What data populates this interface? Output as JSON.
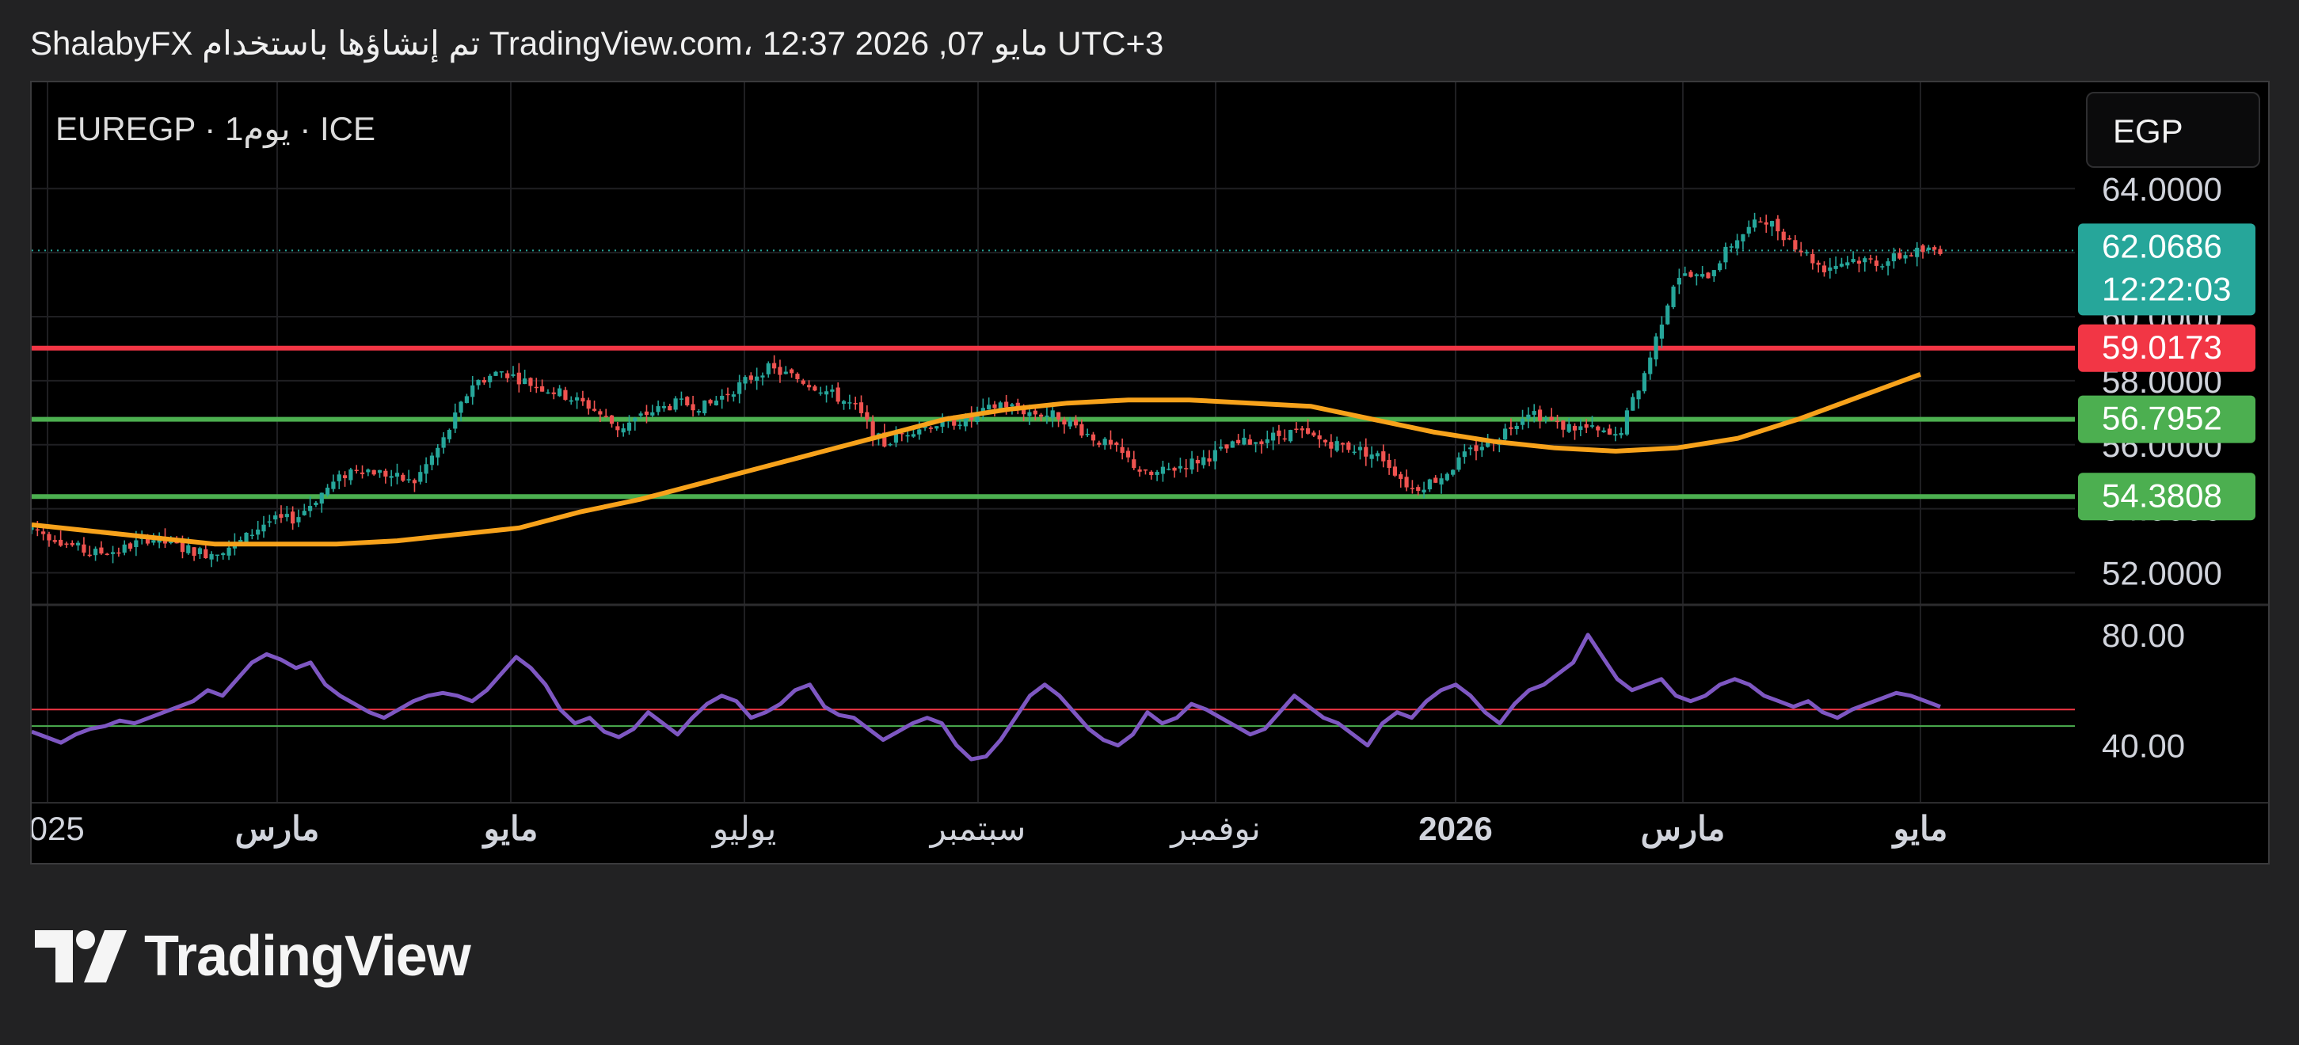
{
  "header": {
    "attribution": "ShalabyFX تم إنشاؤها باستخدام TradingView.com، 12:37 2026 ,07 مايو UTC+3"
  },
  "chart_header": {
    "symbol_info": "EUREGP · 1يوم · ICE",
    "currency_button": "EGP"
  },
  "branding": {
    "logo_text": "TradingView",
    "logo_icon": "tradingview-logo-icon"
  },
  "colors": {
    "background": "#222223",
    "pane": "#000000",
    "up": "#26a69a",
    "down": "#ef5350",
    "moving_average": "#f7a21b",
    "rsi": "#7e57c2",
    "resistance": "#f23645",
    "support": "#4caf50",
    "grid": "#1f1f22",
    "axis_text": "#d1d4dc"
  },
  "chart_data": [
    {
      "type": "candlestick",
      "symbol": "EUREGP",
      "timeframe": "1D",
      "exchange": "ICE",
      "currency": "EGP",
      "x_tick_labels": [
        "2025",
        "مارس",
        "مايو",
        "يوليو",
        "سبتمبر",
        "نوفمبر",
        "2026",
        "مارس",
        "مايو"
      ],
      "y_tick_labels": [
        "64.0000",
        "62.0000",
        "60.0000",
        "58.0000",
        "56.0000",
        "54.0000",
        "52.0000"
      ],
      "ylim": [
        51.0,
        64.6
      ],
      "grid": true,
      "last_price": 62.0686,
      "countdown": "12:22:03",
      "horizontal_lines": [
        {
          "value": 59.0173,
          "label": "59.0173",
          "color": "#f23645"
        },
        {
          "value": 56.7952,
          "label": "56.7952",
          "color": "#4caf50"
        },
        {
          "value": 54.3808,
          "label": "54.3808",
          "color": "#4caf50"
        }
      ],
      "close_series": [
        53.4,
        53.0,
        52.6,
        52.7,
        53.1,
        52.8,
        52.6,
        52.9,
        53.6,
        53.7,
        54.6,
        55.3,
        55.1,
        54.8,
        56.1,
        57.9,
        58.3,
        57.9,
        57.6,
        57.2,
        56.5,
        57.0,
        57.3,
        57.2,
        57.8,
        58.4,
        58.1,
        57.7,
        57.2,
        56.0,
        56.5,
        56.7,
        56.8,
        57.3,
        57.0,
        56.9,
        56.3,
        55.8,
        55.0,
        55.3,
        55.6,
        56.0,
        56.2,
        56.4,
        56.1,
        55.9,
        55.6,
        54.6,
        55.0,
        55.8,
        56.3,
        57.1,
        56.6,
        56.5,
        56.2,
        58.4,
        61.3,
        61.2,
        62.4,
        63.1,
        62.3,
        61.5,
        61.8,
        61.7,
        62.0,
        62.1
      ],
      "moving_average_series": [
        53.5,
        53.3,
        53.1,
        52.9,
        52.9,
        52.9,
        53.0,
        53.2,
        53.4,
        53.9,
        54.3,
        54.8,
        55.3,
        55.8,
        56.3,
        56.8,
        57.1,
        57.3,
        57.4,
        57.4,
        57.3,
        57.2,
        56.8,
        56.4,
        56.1,
        55.9,
        55.8,
        55.9,
        56.2,
        56.8,
        57.5,
        58.2
      ],
      "moving_average_label": "",
      "price_scale_labels": [
        "64.0000",
        "56.0000",
        "52.0000"
      ]
    },
    {
      "type": "line",
      "indicator": "RSI",
      "y_tick_labels": [
        "80.00",
        "40.00"
      ],
      "ylim": [
        25,
        88
      ],
      "levels": [
        {
          "value": 53,
          "color": "#f23645"
        },
        {
          "value": 47,
          "color": "#4caf50"
        }
      ],
      "values": [
        45,
        43,
        41,
        44,
        46,
        47,
        49,
        48,
        50,
        52,
        54,
        56,
        60,
        58,
        64,
        70,
        73,
        71,
        68,
        70,
        62,
        58,
        55,
        52,
        50,
        53,
        56,
        58,
        59,
        58,
        56,
        60,
        66,
        72,
        68,
        62,
        53,
        48,
        50,
        45,
        43,
        46,
        52,
        48,
        44,
        50,
        55,
        58,
        56,
        50,
        52,
        55,
        60,
        62,
        54,
        51,
        50,
        46,
        42,
        45,
        48,
        50,
        48,
        40,
        35,
        36,
        42,
        50,
        58,
        62,
        58,
        52,
        46,
        42,
        40,
        44,
        52,
        48,
        50,
        55,
        53,
        50,
        47,
        44,
        46,
        52,
        58,
        54,
        50,
        48,
        44,
        40,
        48,
        52,
        50,
        56,
        60,
        62,
        58,
        52,
        48,
        55,
        60,
        62,
        66,
        70,
        80,
        72,
        64,
        60,
        62,
        64,
        58,
        56,
        58,
        62,
        64,
        62,
        58,
        56,
        54,
        56,
        52,
        50,
        53,
        55,
        57,
        59,
        58,
        56,
        54
      ]
    }
  ]
}
